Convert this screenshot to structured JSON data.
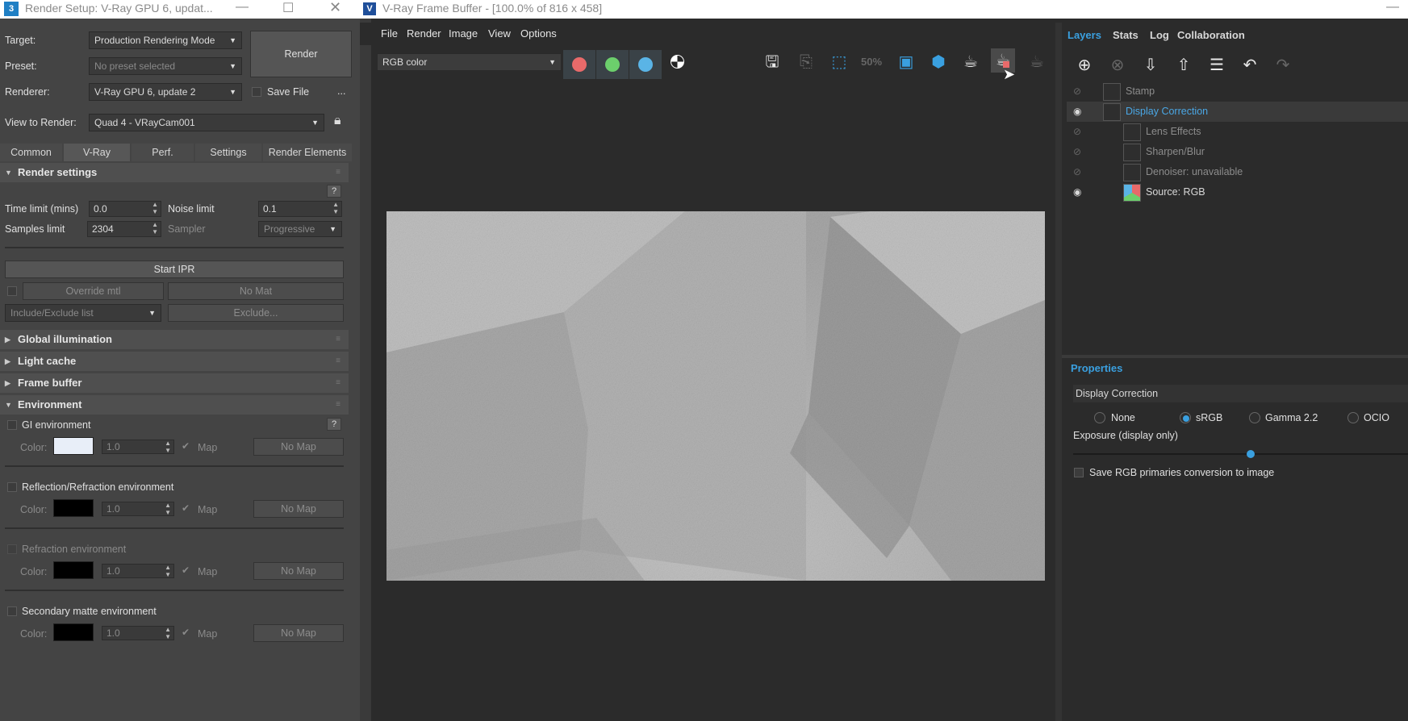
{
  "render_setup": {
    "title": "Render Setup: V-Ray GPU 6, updat...",
    "app_icon": "3",
    "target_label": "Target:",
    "target_value": "Production Rendering Mode",
    "preset_label": "Preset:",
    "preset_value": "No preset selected",
    "renderer_label": "Renderer:",
    "renderer_value": "V-Ray GPU 6, update 2",
    "save_file_label": "Save File",
    "more_label": "...",
    "render_button": "Render",
    "view_label": "View to Render:",
    "view_value": "Quad 4 - VRayCam001",
    "tabs": [
      "Common",
      "V-Ray",
      "Perf.",
      "Settings",
      "Render Elements"
    ],
    "active_tab": "V-Ray",
    "render_settings": {
      "header": "Render settings",
      "help": "?",
      "time_limit_label": "Time limit (mins)",
      "time_limit_value": "0.0",
      "noise_limit_label": "Noise limit",
      "noise_limit_value": "0.1",
      "samples_limit_label": "Samples limit",
      "samples_limit_value": "2304",
      "sampler_label": "Sampler",
      "sampler_value": "Progressive",
      "start_ipr": "Start IPR",
      "override_mtl": "Override mtl",
      "no_mat": "No Mat",
      "include_exclude": "Include/Exclude list",
      "exclude": "Exclude..."
    },
    "rollouts": {
      "gi": "Global illumination",
      "light_cache": "Light cache",
      "frame_buffer": "Frame buffer",
      "environment": "Environment"
    },
    "environment": {
      "help": "?",
      "color_label": "Color:",
      "map_label": "Map",
      "no_map": "No Map",
      "multiplier": "1.0",
      "items": [
        {
          "label": "GI environment",
          "swatch": "#e8eef8"
        },
        {
          "label": "Reflection/Refraction environment",
          "swatch": "#000000"
        },
        {
          "label": "Refraction environment",
          "swatch": "#000000"
        },
        {
          "label": "Secondary matte environment",
          "swatch": "#000000"
        }
      ]
    }
  },
  "vfb": {
    "title": "V-Ray Frame Buffer - [100.0% of 816 x 458]",
    "app_icon": "V",
    "menu": [
      "File",
      "Render",
      "Image",
      "View",
      "Options"
    ],
    "channel_value": "RGB color",
    "toolbar_icons": [
      "save-icon",
      "clear-icon",
      "region-select-icon",
      "50-percent-icon",
      "region-render-icon",
      "track-mouse-icon",
      "render-teapot-icon",
      "stop-render-teapot-icon",
      "interactive-teapot-icon"
    ],
    "zoom_icon_text": "50%",
    "colors": {
      "red": "#e86a6a",
      "green": "#6ccf6c",
      "blue": "#5ab4e6",
      "accent": "#3aa0e0"
    }
  },
  "layers_panel": {
    "tabs": [
      "Layers",
      "Stats",
      "Log",
      "Collaboration"
    ],
    "active_tab": "Layers",
    "layers": [
      {
        "name": "Stamp",
        "visible": false,
        "indent": 0
      },
      {
        "name": "Display Correction",
        "visible": true,
        "indent": 0,
        "selected": true
      },
      {
        "name": "Lens Effects",
        "visible": false,
        "indent": 1
      },
      {
        "name": "Sharpen/Blur",
        "visible": false,
        "indent": 1
      },
      {
        "name": "Denoiser: unavailable",
        "visible": false,
        "indent": 1
      },
      {
        "name": "Source: RGB",
        "visible": true,
        "indent": 1
      }
    ],
    "properties": {
      "header": "Properties",
      "layer_name": "Display Correction",
      "options": [
        "None",
        "sRGB",
        "Gamma 2.2",
        "OCIO"
      ],
      "selected_option": "sRGB",
      "exposure_label": "Exposure (display only)",
      "save_primaries_label": "Save RGB primaries conversion to image"
    }
  }
}
